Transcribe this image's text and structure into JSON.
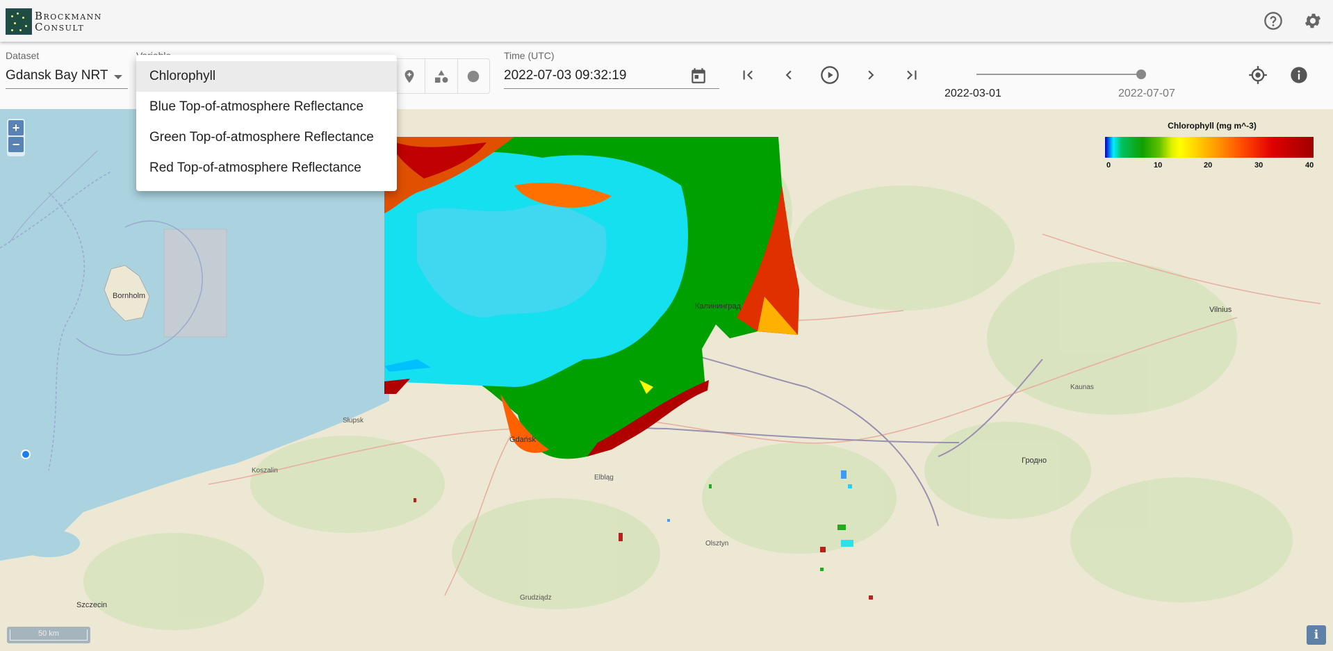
{
  "header": {
    "logo_line1": "Brockmann",
    "logo_line2": "Consult",
    "help_icon": "help-circle-icon",
    "settings_icon": "gear-icon"
  },
  "toolbar": {
    "dataset": {
      "label": "Dataset",
      "value": "Gdansk Bay NRT"
    },
    "variable": {
      "label": "Variable"
    },
    "time": {
      "label": "Time (UTC)",
      "value": "2022-07-03 09:32:19"
    },
    "slider": {
      "start_label": "2022-03-01",
      "end_label": "2022-07-07",
      "position": 0.98
    },
    "icons": [
      "place-icon",
      "shapes-icon",
      "circle-icon",
      "calendar-icon",
      "skip-first-icon",
      "prev-icon",
      "play-icon",
      "next-icon",
      "skip-last-icon",
      "locate-icon",
      "info-icon"
    ]
  },
  "variable_menu": {
    "items": [
      {
        "label": "Chlorophyll",
        "selected": true
      },
      {
        "label": "Blue Top-of-atmosphere Reflectance",
        "selected": false
      },
      {
        "label": "Green Top-of-atmosphere Reflectance",
        "selected": false
      },
      {
        "label": "Red Top-of-atmosphere Reflectance",
        "selected": false
      }
    ]
  },
  "map": {
    "zoom_in": "+",
    "zoom_out": "−",
    "scale_label": "50 km",
    "attribution": "i",
    "labels": [
      "Bornholm",
      "Калининград",
      "Gdańsk",
      "Vilnius",
      "Гродно",
      "Szczecin",
      "Elbląg",
      "Olsztyn",
      "Koszalin",
      "Słupsk",
      "Grudziądz",
      "Kaunas"
    ],
    "legend": {
      "title": "Chlorophyll (mg m^-3)",
      "ticks": [
        "0",
        "10",
        "20",
        "30",
        "40"
      ],
      "range": [
        0,
        40
      ]
    }
  }
}
